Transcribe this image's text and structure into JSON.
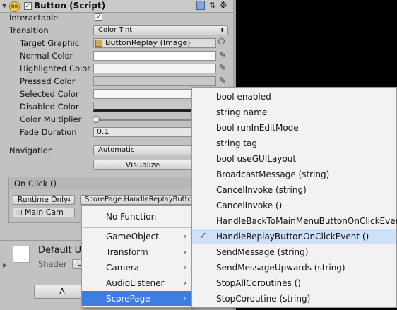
{
  "component": {
    "title": "Button (Script)",
    "ok_badge": "OK",
    "enabled_check": "✓"
  },
  "props": {
    "interactable_label": "Interactable",
    "interactable_check": "✓",
    "transition_label": "Transition",
    "transition_value": "Color Tint",
    "target_graphic_label": "Target Graphic",
    "target_graphic_value": "ButtonReplay (Image)",
    "normal_color_label": "Normal Color",
    "highlighted_color_label": "Highlighted Color",
    "pressed_color_label": "Pressed Color",
    "selected_color_label": "Selected Color",
    "disabled_color_label": "Disabled Color",
    "color_multiplier_label": "Color Multiplier",
    "fade_duration_label": "Fade Duration",
    "fade_duration_value": "0.1",
    "navigation_label": "Navigation",
    "navigation_value": "Automatic",
    "visualize_label": "Visualize"
  },
  "onclick": {
    "header": "On Click ()",
    "runtime_value": "Runtime Only",
    "function_value": "ScorePage.HandleReplayButto",
    "object_value": "Main Cam"
  },
  "material": {
    "name": "Default U",
    "shader_label": "Shader",
    "shader_value": "U",
    "bottom_button": "A"
  },
  "menu1": {
    "items": [
      {
        "label": "No Function",
        "submenu": false
      },
      {
        "label": "GameObject",
        "submenu": true
      },
      {
        "label": "Transform",
        "submenu": true
      },
      {
        "label": "Camera",
        "submenu": true
      },
      {
        "label": "AudioListener",
        "submenu": true
      },
      {
        "label": "ScorePage",
        "submenu": true
      }
    ],
    "chevron": "›"
  },
  "menu2": {
    "items": [
      {
        "label": "bool enabled"
      },
      {
        "label": "string name"
      },
      {
        "label": "bool runInEditMode"
      },
      {
        "label": "string tag"
      },
      {
        "label": "bool useGUILayout"
      },
      {
        "label": "BroadcastMessage (string)"
      },
      {
        "label": "CancelInvoke (string)"
      },
      {
        "label": "CancelInvoke ()"
      },
      {
        "label": "HandleBackToMainMenuButtonOnClickEvent ()"
      },
      {
        "label": "HandleReplayButtonOnClickEvent ()",
        "checked": true
      },
      {
        "label": "SendMessage (string)"
      },
      {
        "label": "SendMessageUpwards (string)"
      },
      {
        "label": "StopAllCoroutines ()"
      },
      {
        "label": "StopCoroutine (string)"
      }
    ],
    "check_glyph": "✓"
  },
  "colors": {
    "selection": "#3e7ee0",
    "checked_row": "#cfe1f8"
  }
}
